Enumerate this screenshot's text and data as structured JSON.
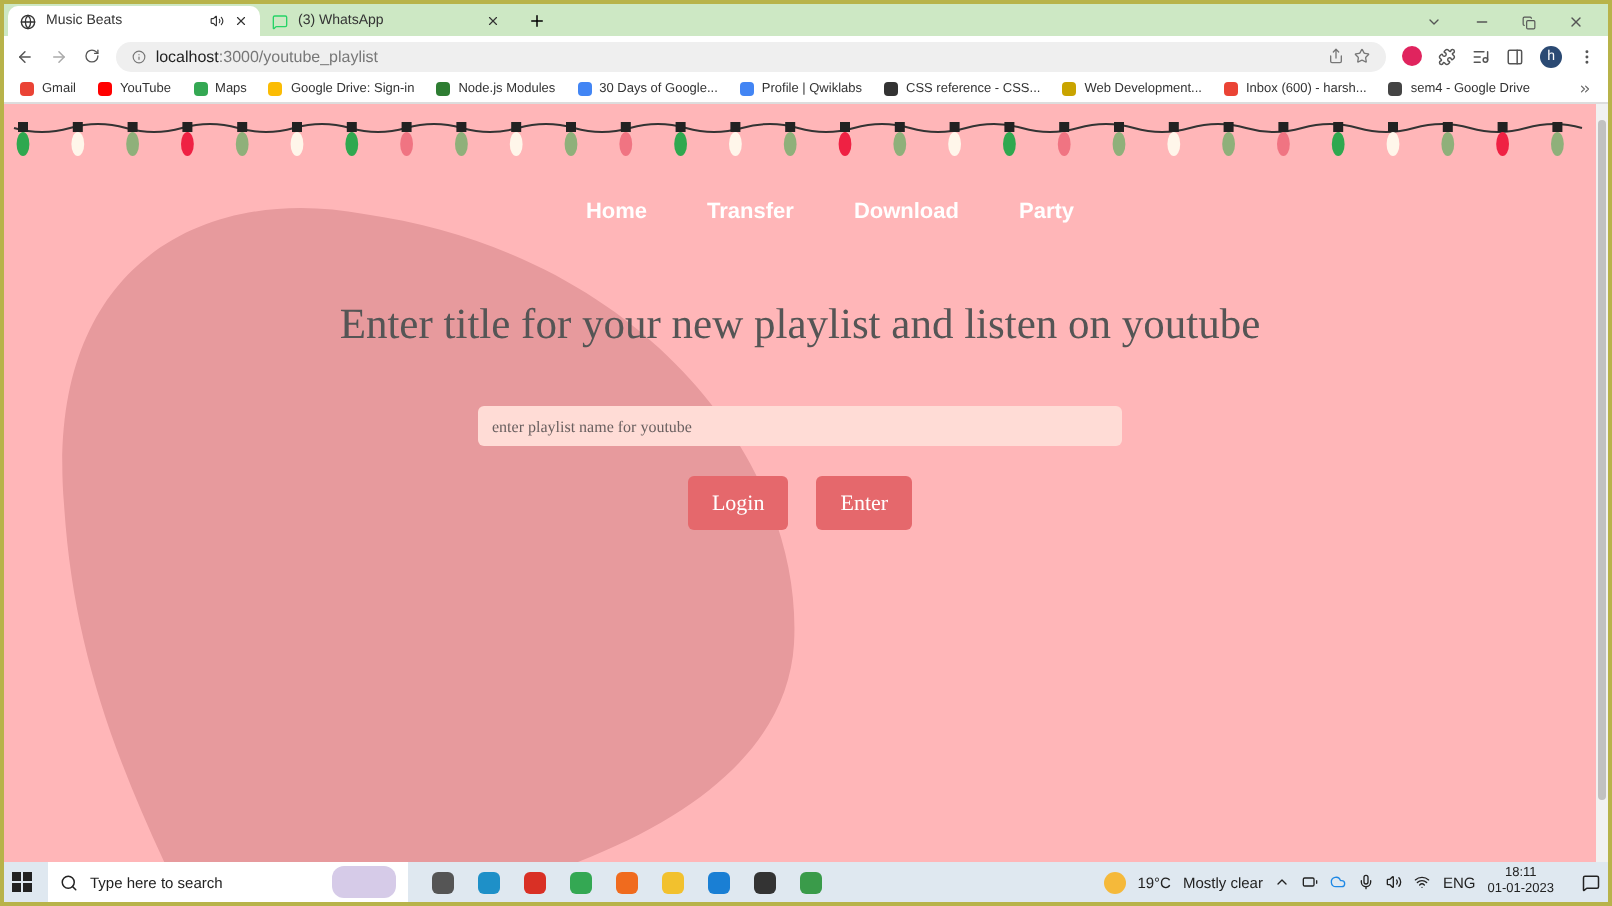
{
  "browser": {
    "tabs": [
      {
        "title": "Music Beats",
        "selected": true,
        "kind": "audio"
      },
      {
        "title": "(3) WhatsApp",
        "selected": false,
        "kind": "plain"
      }
    ],
    "url_host": "localhost",
    "url_path": ":3000/youtube_playlist",
    "bookmarks": [
      {
        "label": "Gmail",
        "color": "#ea4335"
      },
      {
        "label": "YouTube",
        "color": "#ff0000"
      },
      {
        "label": "Maps",
        "color": "#34a853"
      },
      {
        "label": "Google Drive: Sign-in",
        "color": "#fbbc04"
      },
      {
        "label": "Node.js Modules",
        "color": "#2e7d32"
      },
      {
        "label": "30 Days of Google...",
        "color": "#4285f4"
      },
      {
        "label": "Profile | Qwiklabs",
        "color": "#4285f4"
      },
      {
        "label": "CSS reference - CSS...",
        "color": "#333333"
      },
      {
        "label": "Web Development...",
        "color": "#c9a400"
      },
      {
        "label": "Inbox (600) - harsh...",
        "color": "#ea4335"
      },
      {
        "label": "sem4 - Google Drive",
        "color": "#444444"
      }
    ],
    "profile_initial": "h"
  },
  "page": {
    "nav": [
      "Home",
      "Transfer",
      "Download",
      "Party"
    ],
    "heading": "Enter title for your new playlist and listen on youtube",
    "input": {
      "placeholder": "enter playlist name for youtube"
    },
    "buttons": [
      "Login",
      "Enter"
    ]
  },
  "taskbar": {
    "search_placeholder": "Type here to search",
    "temperature": "19°C",
    "weather": "Mostly clear",
    "language": "ENG",
    "time": "18:11",
    "date": "01-01-2023"
  }
}
